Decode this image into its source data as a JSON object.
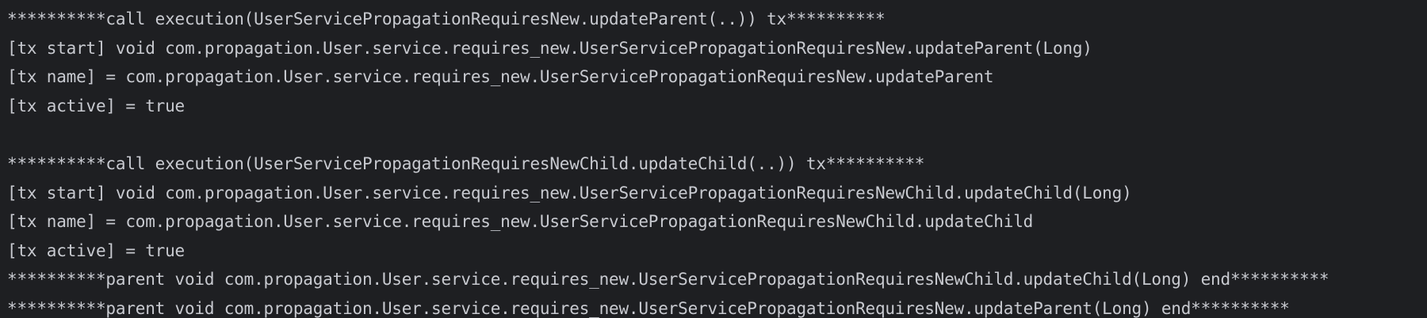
{
  "console": {
    "lines": [
      "**********call execution(UserServicePropagationRequiresNew.updateParent(..)) tx**********",
      "[tx start] void com.propagation.User.service.requires_new.UserServicePropagationRequiresNew.updateParent(Long)",
      "[tx name] = com.propagation.User.service.requires_new.UserServicePropagationRequiresNew.updateParent",
      "[tx active] = true",
      "",
      "**********call execution(UserServicePropagationRequiresNewChild.updateChild(..)) tx**********",
      "[tx start] void com.propagation.User.service.requires_new.UserServicePropagationRequiresNewChild.updateChild(Long)",
      "[tx name] = com.propagation.User.service.requires_new.UserServicePropagationRequiresNewChild.updateChild",
      "[tx active] = true",
      "**********parent void com.propagation.User.service.requires_new.UserServicePropagationRequiresNewChild.updateChild(Long) end**********",
      "**********parent void com.propagation.User.service.requires_new.UserServicePropagationRequiresNew.updateParent(Long) end**********"
    ]
  }
}
